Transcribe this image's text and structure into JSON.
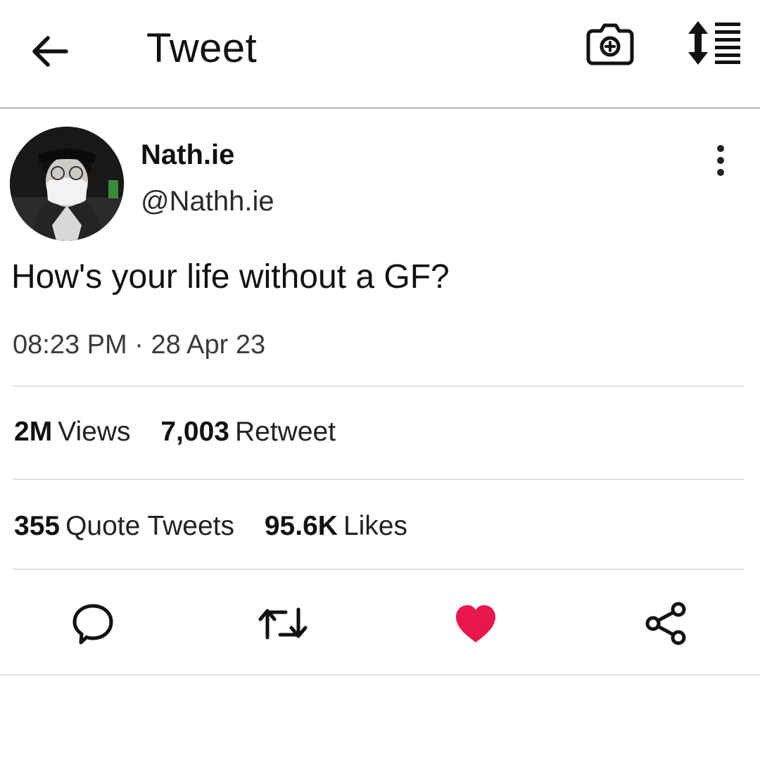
{
  "header": {
    "title": "Tweet",
    "back_icon": "arrow-left-icon",
    "camera_icon": "camera-plus-icon",
    "sort_icon": "sort-list-icon"
  },
  "tweet": {
    "author": {
      "display_name": "Nath.ie",
      "handle": "@Nathh.ie"
    },
    "text": "How's your life without a GF?",
    "time": "08:23 PM",
    "separator": " · ",
    "date": "28 Apr 23",
    "stats": {
      "views": {
        "value": "2M",
        "label": "Views"
      },
      "retweets": {
        "value": "7,003",
        "label": "Retweet"
      },
      "quotes": {
        "value": "355",
        "label": "Quote Tweets"
      },
      "likes": {
        "value": "95.6K",
        "label": "Likes"
      }
    },
    "actions": {
      "reply_icon": "comment-icon",
      "retweet_icon": "retweet-icon",
      "like_icon": "heart-filled-icon",
      "share_icon": "share-icon"
    }
  },
  "colors": {
    "like": "#e8174b",
    "text": "#111111",
    "divider": "#e2e2e2"
  }
}
